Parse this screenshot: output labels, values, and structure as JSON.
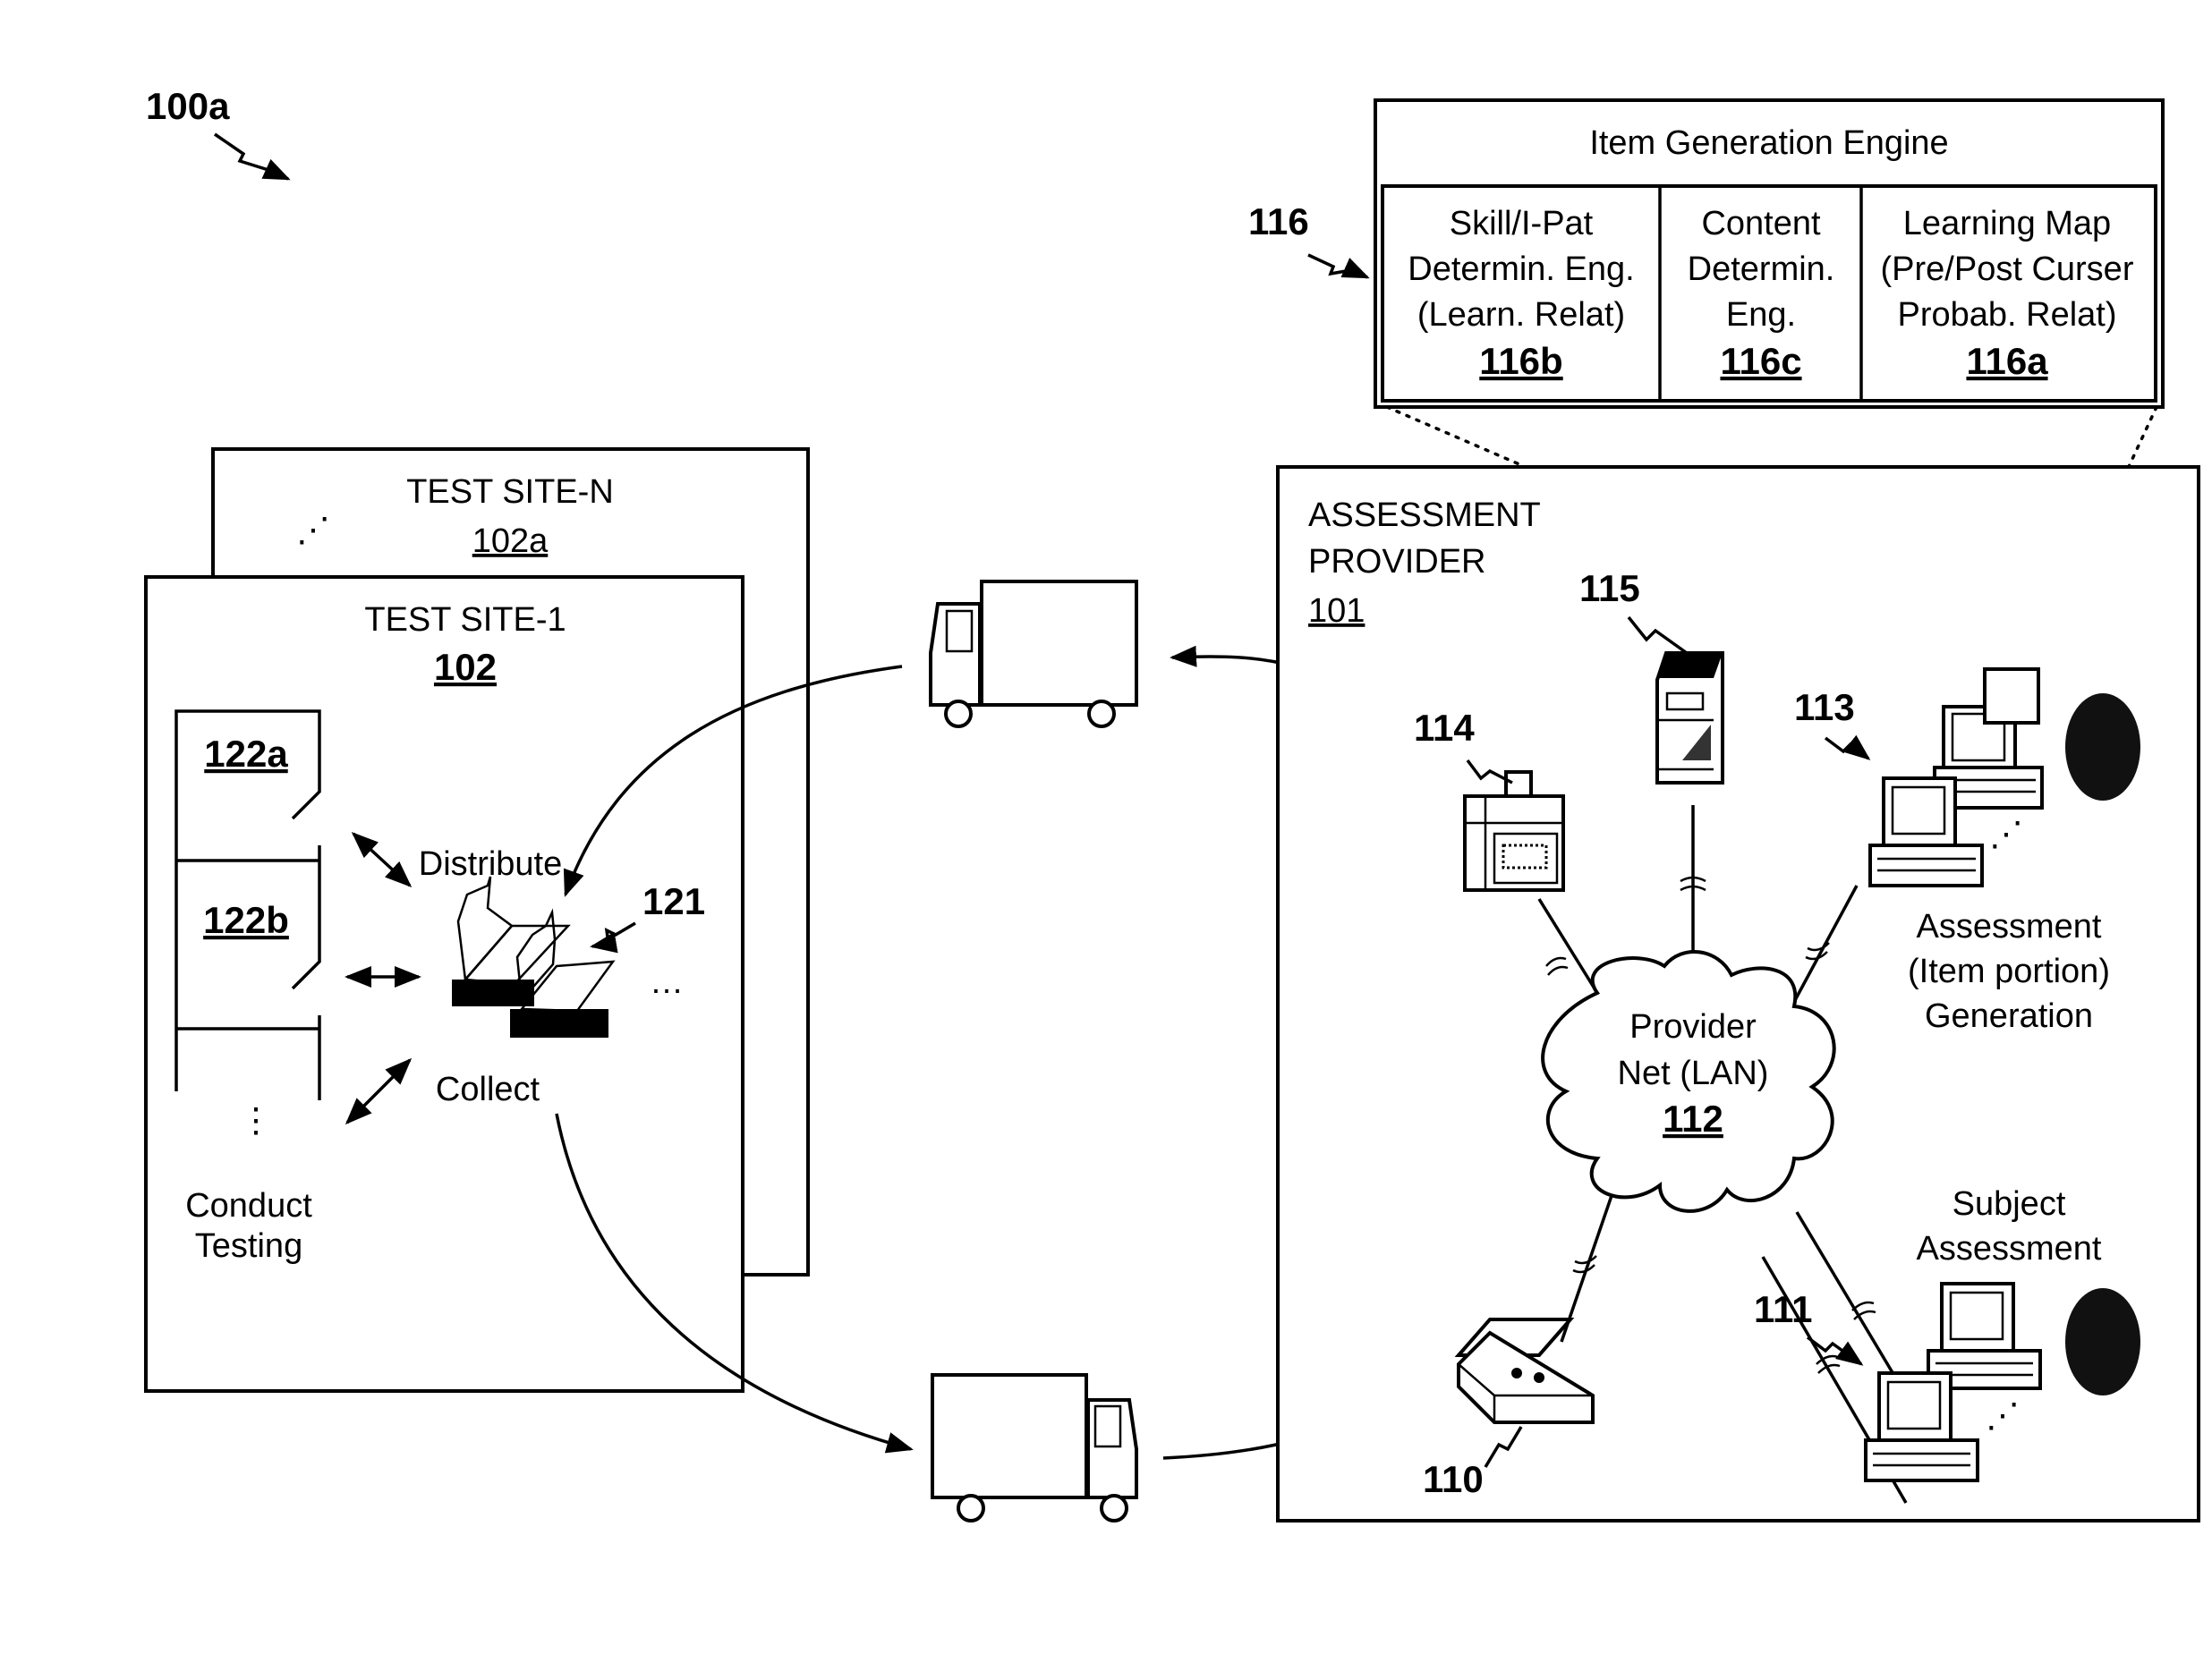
{
  "figure": {
    "label": "100a"
  },
  "item_generation_engine": {
    "title": "Item Generation Engine",
    "ref": "116",
    "modules": [
      {
        "lines": [
          "Skill/I-Pat",
          "Determin. Eng.",
          "(Learn. Relat)"
        ],
        "ref": "116b"
      },
      {
        "lines": [
          "Content",
          "Determin.",
          "Eng."
        ],
        "ref": "116c"
      },
      {
        "lines": [
          "Learning Map",
          "(Pre/Post Curser",
          "Probab. Relat)"
        ],
        "ref": "116a"
      }
    ]
  },
  "test_sites": {
    "site_n": {
      "title": "TEST SITE-N",
      "ref": "102a",
      "ellipsis": "⋰"
    },
    "site_1": {
      "title": "TEST SITE-1",
      "ref": "102"
    },
    "rooms": [
      {
        "ref": "122a"
      },
      {
        "ref": "122b"
      }
    ],
    "rooms_ellipsis": "⋮",
    "conduct_label": [
      "Conduct",
      "Testing"
    ],
    "distribute_label": "Distribute",
    "collect_label": "Collect",
    "test_materials_ref": "121",
    "test_materials_ellipsis": "…"
  },
  "assessment_provider": {
    "title": [
      "ASSESSMENT",
      "PROVIDER"
    ],
    "ref": "101",
    "network": {
      "lines": [
        "Provider",
        "Net (LAN)"
      ],
      "ref": "112"
    },
    "devices": {
      "scanner": {
        "ref": "110",
        "icon": "scanner-icon"
      },
      "subject_terminals": {
        "ref": "111",
        "icon": "computer-icon",
        "caption": [
          "Subject",
          "Assessment"
        ]
      },
      "generation_terminals": {
        "ref": "113",
        "icon": "computer-icon",
        "caption": [
          "Assessment",
          "(Item portion)",
          "Generation"
        ]
      },
      "printer": {
        "ref": "114",
        "icon": "printer-icon"
      },
      "server": {
        "ref": "115",
        "icon": "server-icon"
      }
    }
  },
  "transport": {
    "outbound_icon": "delivery-truck-icon",
    "return_icon": "delivery-truck-icon"
  }
}
